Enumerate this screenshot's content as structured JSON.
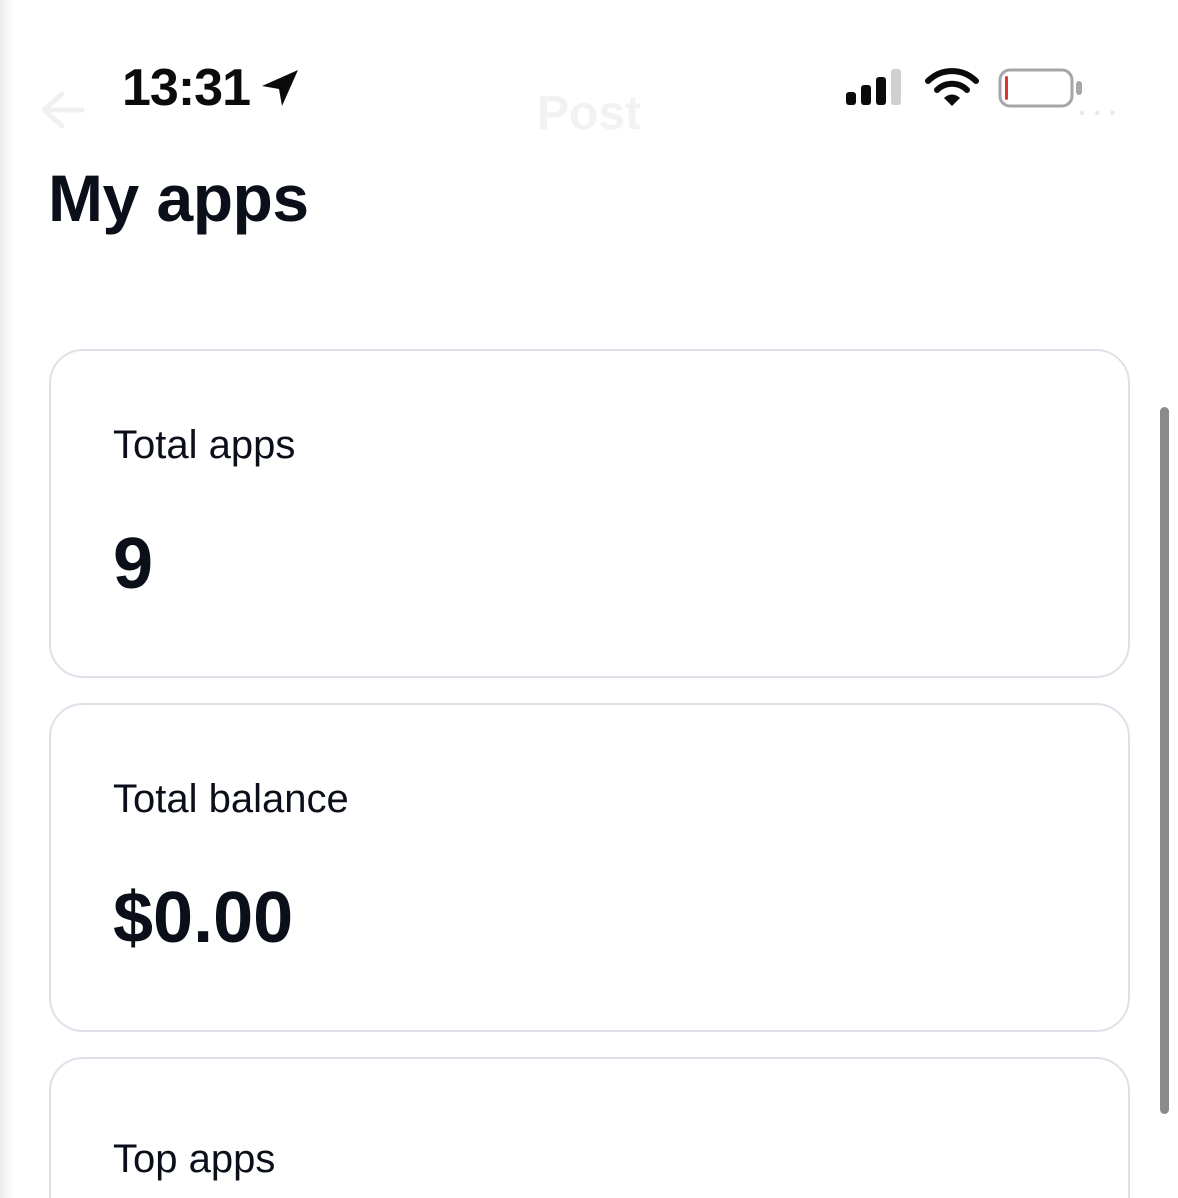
{
  "status_bar": {
    "time": "13:31",
    "location_icon": "location-arrow-icon",
    "signal_icon": "cellular-signal-icon",
    "wifi_icon": "wifi-icon",
    "battery_icon": "battery-low-icon",
    "battery_level_fraction": 0.05,
    "battery_low_color": "#e0342f"
  },
  "nav": {
    "title": "Post",
    "back_icon": "back-arrow-icon",
    "more_icon": "more-icon",
    "more_label": "..."
  },
  "header": {
    "title": "My apps"
  },
  "cards": {
    "total_apps": {
      "label": "Total apps",
      "value": "9"
    },
    "total_balance": {
      "label": "Total balance",
      "value": "$0.00"
    },
    "top_apps": {
      "label": "Top apps"
    }
  },
  "colors": {
    "text": "#0b0f1a",
    "card_border": "#dfe1e8",
    "scrollbar": "#8a8a8d"
  }
}
